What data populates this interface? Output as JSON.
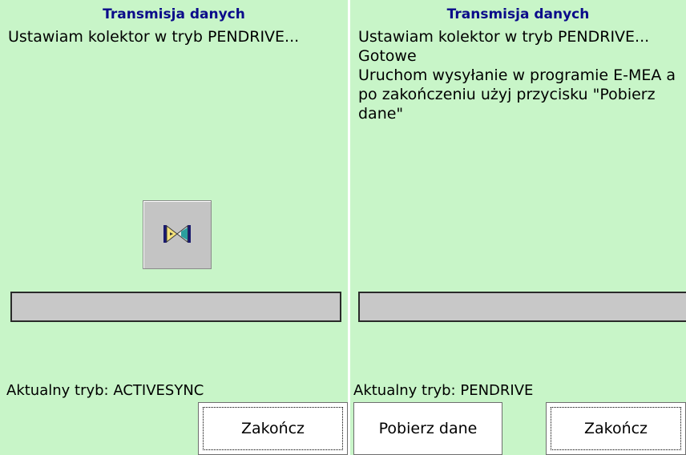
{
  "left_screen": {
    "title": "Transmisja danych",
    "message_lines": [
      "Ustawiam kolektor w tryb PENDRIVE..."
    ],
    "hourglass_icon": "hourglass-icon",
    "mode_label": "Aktualny tryb: ACTIVESYNC",
    "finish_button": "Zakończ"
  },
  "right_screen": {
    "title": "Transmisja danych",
    "message_lines": [
      "Ustawiam kolektor w tryb PENDRIVE...",
      "Gotowe",
      "Uruchom wysyłanie w programie E-MEA a po zakończeniu użyj przycisku \"Pobierz dane\""
    ],
    "mode_label": "Aktualny tryb: PENDRIVE",
    "fetch_button": "Pobierz dane",
    "finish_button": "Zakończ"
  },
  "colors": {
    "background": "#c8f5c8",
    "title": "#0b0b8a",
    "progress_track": "#c8c8c8"
  }
}
